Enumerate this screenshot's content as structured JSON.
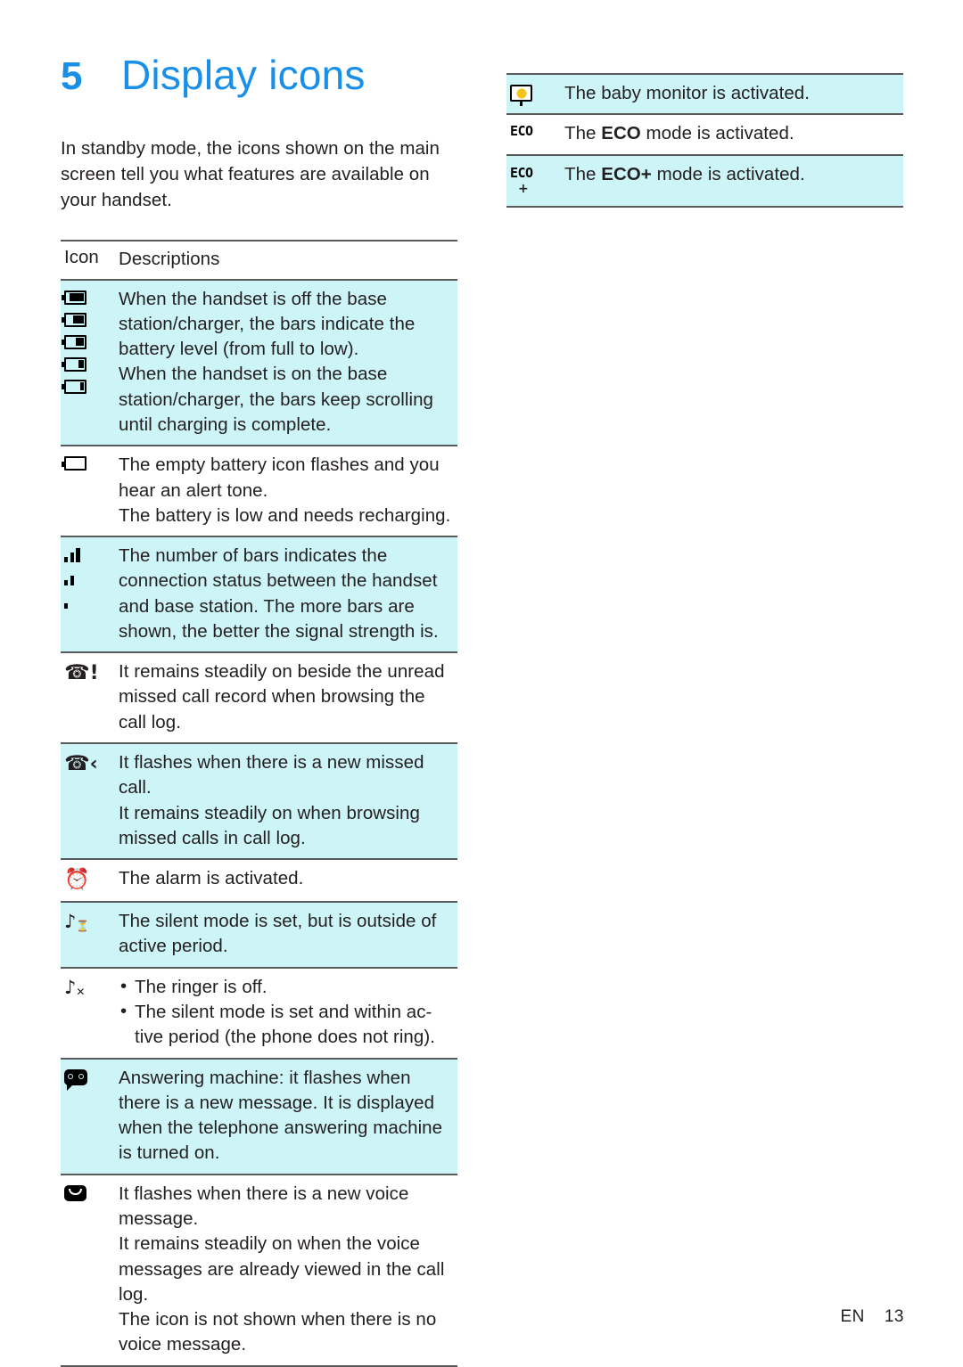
{
  "chapter": {
    "number": "5",
    "title": "Display icons"
  },
  "intro": "In standby mode, the icons shown on the main screen tell you what features are available on your handset.",
  "table": {
    "headers": {
      "icon": "Icon",
      "description": "Descriptions"
    },
    "rows": [
      {
        "icon_type": "battery-levels",
        "lines": [
          "When the handset is off the base",
          "station/charger, the bars indicate the",
          "battery level (from full to low).",
          "When the handset is on the base",
          "station/charger, the bars keep scrolling",
          "until charging is complete."
        ]
      },
      {
        "icon_type": "battery-empty",
        "lines": [
          "The empty battery icon flashes and you",
          "hear an alert tone.",
          "The battery is low and needs recharging."
        ]
      },
      {
        "icon_type": "signal-bars",
        "lines": [
          "The number of bars indicates the",
          "connection status between the handset",
          "and base station. The more bars are",
          "shown, the better the signal strength is."
        ]
      },
      {
        "icon_type": "missed-call-unread",
        "lines": [
          "It remains steadily on beside the unread",
          "missed call record when browsing the",
          "call log."
        ]
      },
      {
        "icon_type": "missed-call-new",
        "lines": [
          "It flashes when there is a new missed",
          "call.",
          "It remains steadily on when browsing",
          "missed calls in call log."
        ]
      },
      {
        "icon_type": "alarm-clock",
        "lines": [
          "The alarm is activated."
        ]
      },
      {
        "icon_type": "silent-mode-outside",
        "lines": [
          "The silent mode is set, but is outside of",
          "active period."
        ]
      },
      {
        "icon_type": "ringer-off",
        "bullets": [
          "The ringer is off.",
          "The silent mode is set and within ac-tive period (the phone does not ring)."
        ]
      },
      {
        "icon_type": "answering-machine",
        "lines": [
          "Answering machine: it flashes when",
          "there is a new message. It is displayed",
          "when the telephone answering machine",
          "is turned on."
        ]
      },
      {
        "icon_type": "voice-message",
        "lines": [
          "It flashes when there is a new voice",
          "message.",
          "It remains steadily on when the voice",
          "messages are already viewed in the call",
          "log.",
          "The icon is not shown when there is no",
          "voice message."
        ]
      }
    ],
    "rows_right": [
      {
        "icon_type": "baby-monitor",
        "text_before": "The baby monitor is activated.",
        "bold": "",
        "text_after": ""
      },
      {
        "icon_type": "eco",
        "text_before": "The ",
        "bold": "ECO",
        "text_after": " mode is activated."
      },
      {
        "icon_type": "eco-plus",
        "text_before": "The ",
        "bold": "ECO+",
        "text_after": " mode is activated."
      }
    ]
  },
  "icon_labels": {
    "battery_full": "battery-full-icon",
    "battery_empty": "battery-empty-icon",
    "signal": "signal-bars-icon",
    "eco": "ECO",
    "eco_plus": "+"
  },
  "footer": {
    "language": "EN",
    "page": "13"
  },
  "colors": {
    "accent": "#1a8fe8",
    "row_highlight": "#cdf4f7",
    "rule": "#58595b",
    "baby_dot": "#f5c518"
  }
}
